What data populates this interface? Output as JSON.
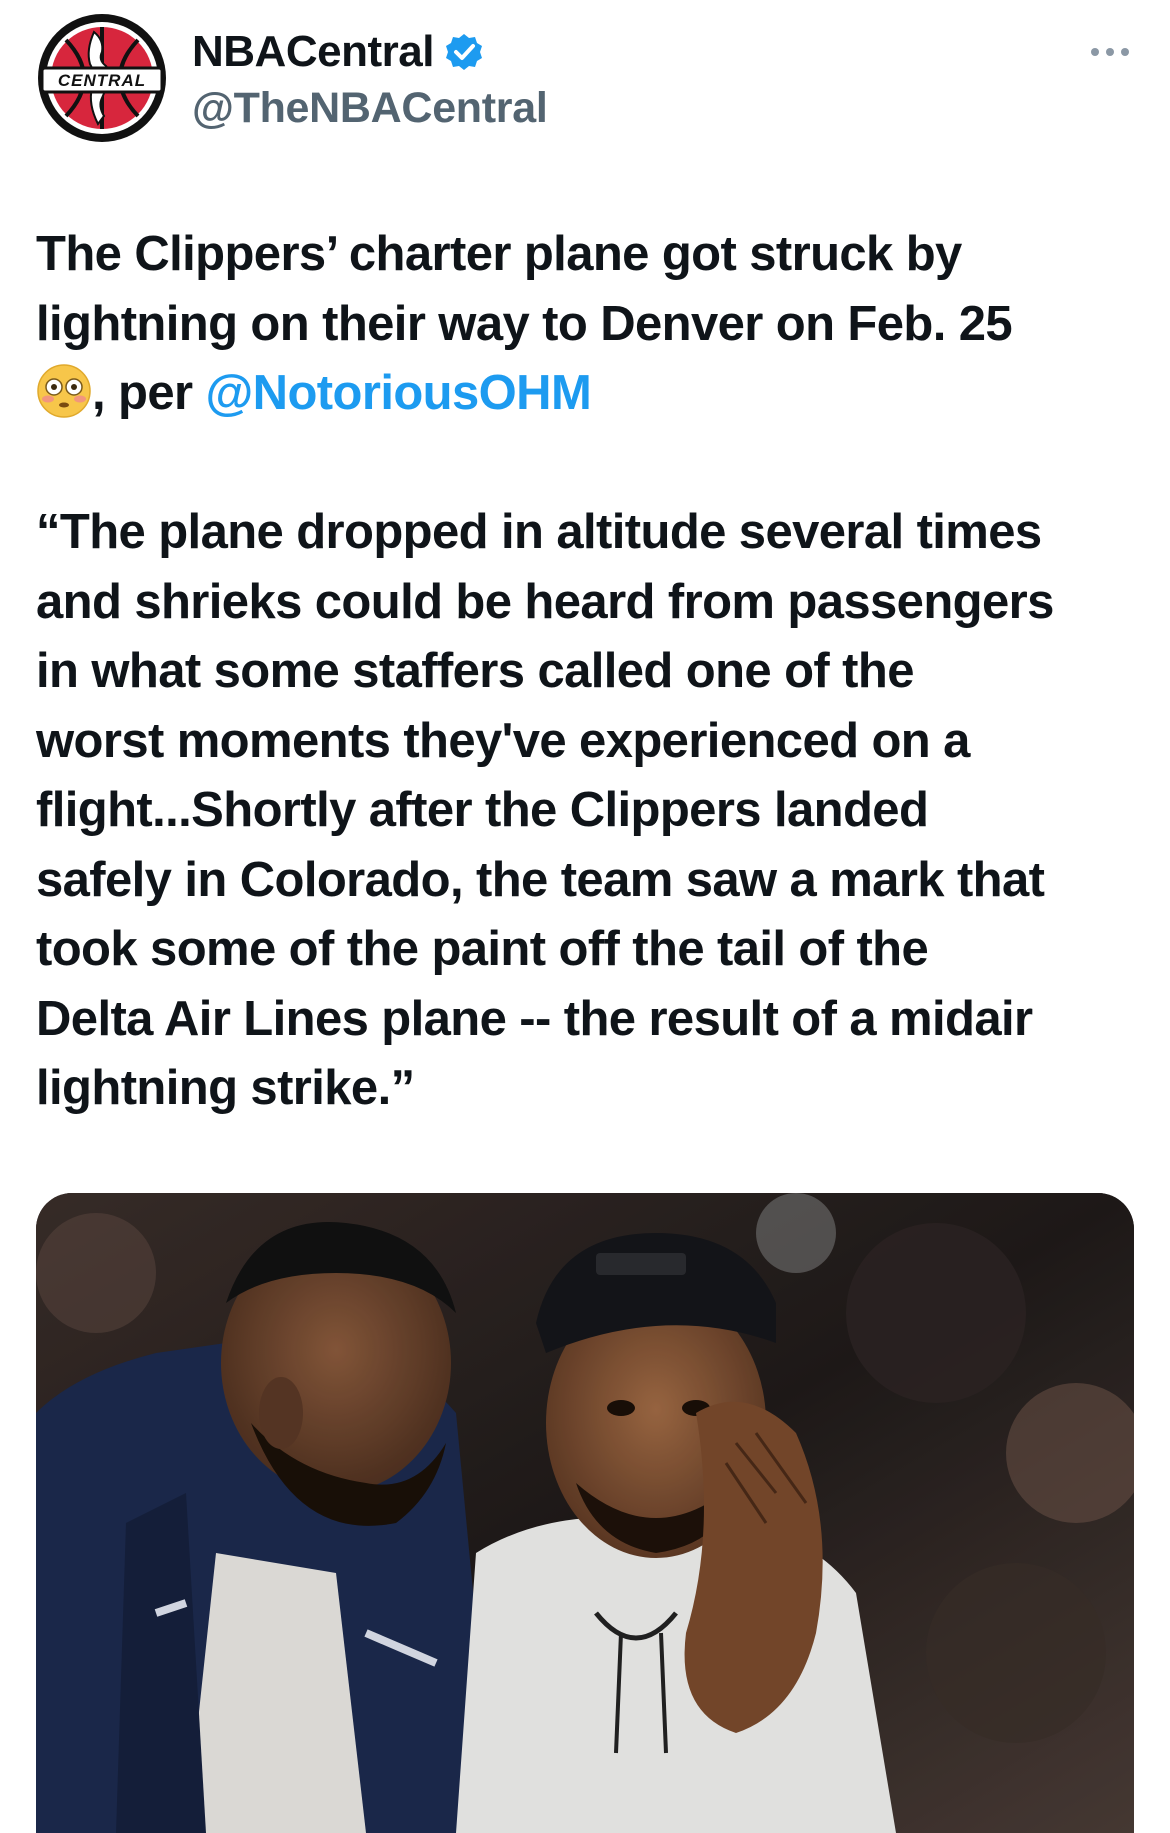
{
  "author": {
    "display_name": "NBACentral",
    "handle": "@TheNBACentral",
    "avatar_text": "CENTRAL",
    "verified": true,
    "verified_color": "#1d9bf0"
  },
  "tweet": {
    "line1": "The Clippers’ charter plane got struck by",
    "line2": "lightning on their way to Denver on Feb. 25",
    "line3_suffix": ", per ",
    "mention": "@NotoriousOHM",
    "emoji": "flushed-face",
    "quote_lines": [
      "“The plane dropped in altitude several times",
      "and shrieks could be heard from passengers",
      "in what some staffers called one of the",
      "worst moments they've experienced on a",
      "flight...Shortly after the Clippers landed",
      "safely in Colorado, the team saw a mark that",
      "took some of the paint off the tail of the",
      "Delta Air Lines plane -- the result of a midair",
      "lightning strike.”"
    ]
  },
  "media": {
    "type": "photo",
    "description_icon": "photo-of-two-players"
  },
  "colors": {
    "text": "#0f1419",
    "secondary": "#536471",
    "link": "#1d9bf0",
    "avatar_red": "#d7263d"
  }
}
